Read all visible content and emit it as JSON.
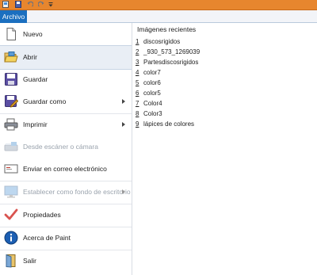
{
  "file_tab": {
    "label": "Archivo"
  },
  "menu": {
    "items": [
      {
        "label": "Nuevo",
        "icon": "new-document-icon",
        "disabled": false,
        "submenu": false
      },
      {
        "label": "Abrir",
        "icon": "open-folder-icon",
        "disabled": false,
        "submenu": false,
        "selected": true
      },
      {
        "label": "Guardar",
        "icon": "floppy-disk-icon",
        "disabled": false,
        "submenu": false
      },
      {
        "label": "Guardar como",
        "icon": "save-as-icon",
        "disabled": false,
        "submenu": true
      },
      {
        "label": "Imprimir",
        "icon": "printer-icon",
        "disabled": false,
        "submenu": true
      },
      {
        "label": "Desde escáner o cámara",
        "icon": "scanner-icon",
        "disabled": true,
        "submenu": false
      },
      {
        "label": "Enviar en correo electrónico",
        "icon": "email-icon",
        "disabled": false,
        "submenu": false
      },
      {
        "label": "Establecer como fondo de escritorio",
        "icon": "desktop-background-icon",
        "disabled": true,
        "submenu": true
      },
      {
        "label": "Propiedades",
        "icon": "checkmark-icon",
        "disabled": false,
        "submenu": false
      },
      {
        "label": "Acerca de Paint",
        "icon": "info-icon",
        "disabled": false,
        "submenu": false
      },
      {
        "label": "Salir",
        "icon": "exit-icon",
        "disabled": false,
        "submenu": false
      }
    ]
  },
  "recent": {
    "title": "Imágenes recientes",
    "items": [
      {
        "num": "1",
        "name": "discosrigidos"
      },
      {
        "num": "2",
        "name": "_930_573_1269039"
      },
      {
        "num": "3",
        "name": "Partesdiscosrigidos"
      },
      {
        "num": "4",
        "name": "color7"
      },
      {
        "num": "5",
        "name": "color6"
      },
      {
        "num": "6",
        "name": "color5"
      },
      {
        "num": "7",
        "name": "Color4"
      },
      {
        "num": "8",
        "name": "Color3"
      },
      {
        "num": "9",
        "name": "lápices de colores"
      }
    ]
  },
  "colors": {
    "titlebar": "#e7862e",
    "file_tab": "#1b6fbf",
    "selected": "#e9eef5"
  }
}
